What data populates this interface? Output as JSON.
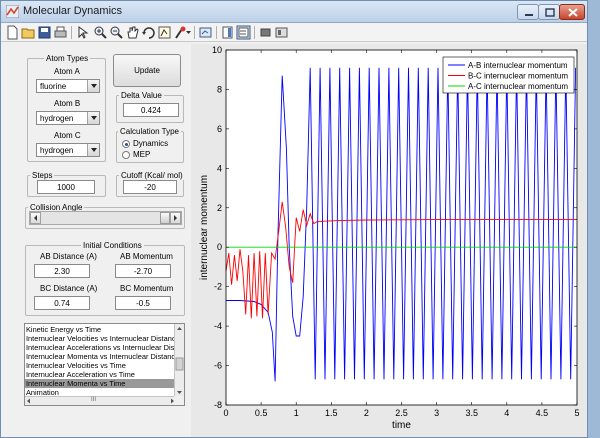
{
  "window": {
    "title": "Molecular Dynamics"
  },
  "atom_types": {
    "title": "Atom Types",
    "atom_a": {
      "label": "Atom A",
      "value": "fluorine"
    },
    "atom_b": {
      "label": "Atom B",
      "value": "hydrogen"
    },
    "atom_c": {
      "label": "Atom C",
      "value": "hydrogen"
    }
  },
  "update_label": "Update",
  "delta": {
    "title": "Delta Value",
    "value": "0.424"
  },
  "calc_type": {
    "title": "Calculation Type",
    "options": [
      "Dynamics",
      "MEP"
    ],
    "selected": "Dynamics"
  },
  "steps": {
    "title": "Steps",
    "value": "1000"
  },
  "cutoff": {
    "title": "Cutoff (Kcal/ mol)",
    "value": "-20"
  },
  "collision": {
    "title": "Collision Angle"
  },
  "initial": {
    "title": "Initial Conditions",
    "ab_distance": {
      "label": "AB Distance (A)",
      "value": "2.30"
    },
    "ab_momentum": {
      "label": "AB Momentum",
      "value": "-2.70"
    },
    "bc_distance": {
      "label": "BC Distance (A)",
      "value": "0.74"
    },
    "bc_momentum": {
      "label": "BC Momentum",
      "value": "-0.5"
    }
  },
  "plot_list": {
    "items": [
      "Kinetic Energy vs Time",
      "Internuclear Velocities vs Internuclear Distance",
      "Internuclear Accelerations vs Internuclear Distance",
      "Internuclear Momenta vs Internuclear Distance",
      "Internuclear Velocities vs Time",
      "Internuclear Acceleration vs Time",
      "Internuclear Momenta vs Time",
      "Animation"
    ],
    "selected": "Internuclear Momenta vs Time",
    "scroll_glyph": "III"
  },
  "chart_data": {
    "type": "line",
    "xlabel": "time",
    "ylabel": "internuclear momentum",
    "xlim": [
      0,
      5
    ],
    "ylim": [
      -8,
      10
    ],
    "xticks": [
      "0",
      "0.5",
      "1",
      "1.5",
      "2",
      "2.5",
      "3",
      "3.5",
      "4",
      "4.5",
      "5"
    ],
    "yticks": [
      "-8",
      "-6",
      "-4",
      "-2",
      "0",
      "2",
      "4",
      "6",
      "8",
      "10"
    ],
    "legend": "top-right",
    "grid": false,
    "series": [
      {
        "name": "A-B internuclear momentum",
        "color": "#0000ff",
        "x": [
          0,
          0.2,
          0.4,
          0.5,
          0.6,
          0.66,
          0.7,
          0.74,
          0.8,
          0.86,
          0.9,
          0.95,
          1.0,
          1.05,
          1.1,
          1.15,
          1.2,
          1.27,
          1.34,
          1.41,
          1.48,
          1.55,
          1.62,
          1.69,
          1.76,
          1.83,
          1.9,
          1.97,
          2.04,
          2.11,
          2.18,
          2.25,
          2.32,
          2.39,
          2.46,
          2.53,
          2.6,
          2.67,
          2.74,
          2.81,
          2.88,
          2.95,
          3.02,
          3.09,
          3.16,
          3.23,
          3.3,
          3.37,
          3.44,
          3.51,
          3.58,
          3.65,
          3.72,
          3.79,
          3.86,
          3.93,
          4.0,
          4.07,
          4.14,
          4.21,
          4.28,
          4.35,
          4.42,
          4.49,
          4.56,
          4.63,
          4.7,
          4.77,
          4.84,
          4.91,
          4.98
        ],
        "y": [
          -2.7,
          -2.7,
          -2.75,
          -2.9,
          -3.3,
          -4.3,
          -6.8,
          0.5,
          8.7,
          5.0,
          0.0,
          -3.5,
          -4.5,
          -4.5,
          -2.5,
          2.0,
          9.1,
          -6.7,
          9.1,
          -6.7,
          9.1,
          -6.7,
          9.1,
          -6.7,
          9.1,
          -6.7,
          9.1,
          -6.7,
          9.1,
          -6.7,
          9.1,
          -6.7,
          9.1,
          -6.7,
          9.1,
          -6.7,
          9.1,
          -6.7,
          9.1,
          -6.7,
          9.1,
          -6.7,
          9.1,
          -6.7,
          9.1,
          -6.7,
          9.1,
          -6.7,
          9.1,
          -6.7,
          9.1,
          -6.7,
          9.1,
          -6.7,
          9.1,
          -6.7,
          9.1,
          -6.7,
          9.1,
          -6.7,
          9.1,
          -6.7,
          9.1,
          -6.7,
          9.1,
          -6.7,
          9.1,
          -6.7,
          9.1,
          -6.7,
          9.1
        ]
      },
      {
        "name": "B-C internuclear momentum",
        "color": "#ff0000",
        "x": [
          0,
          0.04,
          0.08,
          0.12,
          0.16,
          0.2,
          0.24,
          0.28,
          0.32,
          0.36,
          0.4,
          0.44,
          0.48,
          0.52,
          0.56,
          0.6,
          0.65,
          0.7,
          0.75,
          0.8,
          0.85,
          0.9,
          0.95,
          1.0,
          1.05,
          1.1,
          1.15,
          1.2,
          1.25,
          1.3,
          1.4,
          1.6,
          2.0,
          3.0,
          4.0,
          5.0
        ],
        "y": [
          -1.2,
          -0.3,
          -1.9,
          -0.4,
          -1.7,
          -0.1,
          -1.2,
          -3.4,
          -0.4,
          -3.6,
          -0.3,
          -3.5,
          -0.2,
          -3.6,
          -0.3,
          -3.4,
          -0.3,
          -0.6,
          0.8,
          2.3,
          1.0,
          -1.0,
          -1.8,
          1.5,
          0.8,
          1.9,
          1.1,
          1.7,
          1.2,
          1.3,
          1.32,
          1.35,
          1.38,
          1.4,
          1.4,
          1.4
        ]
      },
      {
        "name": "A-C internuclear momentum",
        "color": "#00d800",
        "x": [
          0,
          5
        ],
        "y": [
          0,
          0
        ]
      }
    ]
  }
}
